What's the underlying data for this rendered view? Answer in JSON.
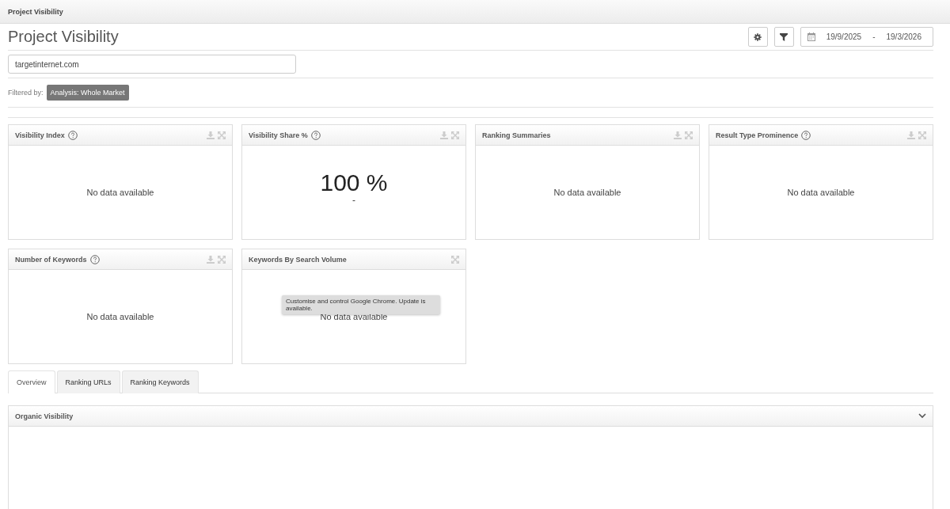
{
  "top_bar": {
    "title": "Project Visibility"
  },
  "page": {
    "title": "Project Visibility"
  },
  "toolbar": {
    "date_from": "19/9/2025",
    "date_separator": "-",
    "date_to": "19/3/2026"
  },
  "domain_field": {
    "value": "targetinternet.com"
  },
  "filter": {
    "label": "Filtered by:",
    "tags": [
      "Analysis: Whole Market"
    ]
  },
  "widgets": [
    {
      "title": "Visibility Index",
      "help": true,
      "download": true,
      "expand": true,
      "kind": "empty",
      "message": "No data available"
    },
    {
      "title": "Visibility Share %",
      "help": true,
      "download": true,
      "expand": true,
      "kind": "value",
      "value": "100 %",
      "sub": "-"
    },
    {
      "title": "Ranking Summaries",
      "help": false,
      "download": true,
      "expand": true,
      "kind": "empty",
      "message": "No data available"
    },
    {
      "title": "Result Type Prominence",
      "help": true,
      "download": true,
      "expand": true,
      "kind": "empty",
      "message": "No data available"
    },
    {
      "title": "Number of Keywords",
      "help": true,
      "download": true,
      "expand": true,
      "kind": "empty",
      "message": "No data available"
    },
    {
      "title": "Keywords By Search Volume",
      "help": false,
      "download": false,
      "expand": true,
      "kind": "empty",
      "message": "No data available",
      "tooltip": "Customise and control Google Chrome. Update is available."
    }
  ],
  "tabs": [
    {
      "label": "Overview",
      "selected": true
    },
    {
      "label": "Ranking URLs",
      "selected": false
    },
    {
      "label": "Ranking Keywords",
      "selected": false
    }
  ],
  "panel": {
    "title": "Organic Visibility",
    "expanded": true
  }
}
